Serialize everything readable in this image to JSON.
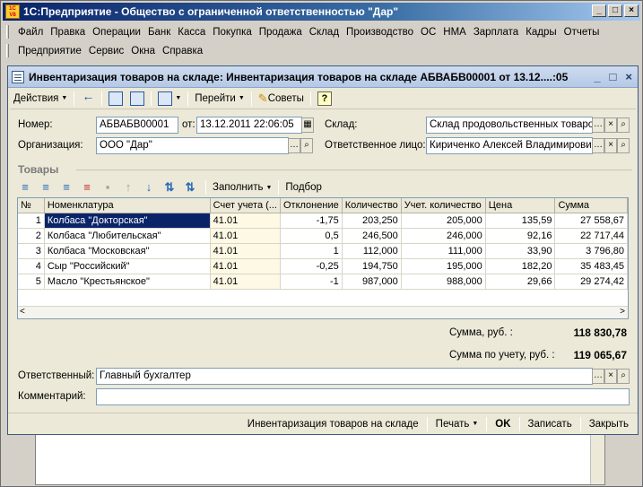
{
  "app": {
    "logo_text": "1C V8",
    "title": "1С:Предприятие - Общество с ограниченной ответственностью \"Дар\"",
    "window_buttons": [
      "_",
      "□",
      "×"
    ]
  },
  "menu": {
    "row1": [
      "Файл",
      "Правка",
      "Операции",
      "Банк",
      "Касса",
      "Покупка",
      "Продажа",
      "Склад",
      "Производство",
      "ОС",
      "НМА",
      "Зарплата",
      "Кадры",
      "Отчеты"
    ],
    "row2": [
      "Предприятие",
      "Сервис",
      "Окна",
      "Справка"
    ]
  },
  "document": {
    "title": "Инвентаризация товаров на складе: Инвентаризация товаров на складе АБВАБВ00001 от 13.12....:05",
    "window_buttons": [
      "_",
      "□",
      "×"
    ],
    "toolbar": {
      "actions_label": "Действия",
      "goto_label": "Перейти",
      "tips_label": "Советы",
      "help_label": "?"
    },
    "fields": {
      "number_label": "Номер:",
      "number_value": "АБВАБВ00001",
      "date_label": "от:",
      "date_value": "13.12.2011 22:06:05",
      "warehouse_label": "Склад:",
      "warehouse_value": "Склад продовольственных товаров",
      "organization_label": "Организация:",
      "organization_value": "ООО \"Дар\"",
      "responsible_person_label": "Ответственное лицо:",
      "responsible_person_value": "Кириченко Алексей Владимирович"
    },
    "goods_section_title": "Товары",
    "grid_toolbar": {
      "fill_label": "Заполнить",
      "select_label": "Подбор"
    },
    "table": {
      "columns": [
        "№",
        "Номенклатура",
        "Счет учета (...",
        "Отклонение",
        "Количество",
        "Учет. количество",
        "Цена",
        "Сумма"
      ],
      "rows": [
        {
          "n": "1",
          "name": "Колбаса \"Докторская\"",
          "account": "41.01",
          "deviation": "-1,75",
          "qty": "203,250",
          "acc_qty": "205,000",
          "price": "135,59",
          "sum": "27 558,67"
        },
        {
          "n": "2",
          "name": "Колбаса \"Любительская\"",
          "account": "41.01",
          "deviation": "0,5",
          "qty": "246,500",
          "acc_qty": "246,000",
          "price": "92,16",
          "sum": "22 717,44"
        },
        {
          "n": "3",
          "name": "Колбаса \"Московская\"",
          "account": "41.01",
          "deviation": "1",
          "qty": "112,000",
          "acc_qty": "111,000",
          "price": "33,90",
          "sum": "3 796,80"
        },
        {
          "n": "4",
          "name": "Сыр \"Российский\"",
          "account": "41.01",
          "deviation": "-0,25",
          "qty": "194,750",
          "acc_qty": "195,000",
          "price": "182,20",
          "sum": "35 483,45"
        },
        {
          "n": "5",
          "name": "Масло \"Крестьянское\"",
          "account": "41.01",
          "deviation": "-1",
          "qty": "987,000",
          "acc_qty": "988,000",
          "price": "29,66",
          "sum": "29 274,42"
        }
      ]
    },
    "totals": {
      "sum_label": "Сумма, руб. :",
      "sum_value": "118 830,78",
      "acc_sum_label": "Сумма по учету, руб. :",
      "acc_sum_value": "119 065,67"
    },
    "responsible_label": "Ответственный:",
    "responsible_value": "Главный бухгалтер",
    "comment_label": "Комментарий:",
    "comment_value": "",
    "footer": {
      "print_form_label": "Инвентаризация товаров на складе",
      "print_label": "Печать",
      "ok_label": "OK",
      "save_label": "Записать",
      "close_label": "Закрыть"
    }
  }
}
